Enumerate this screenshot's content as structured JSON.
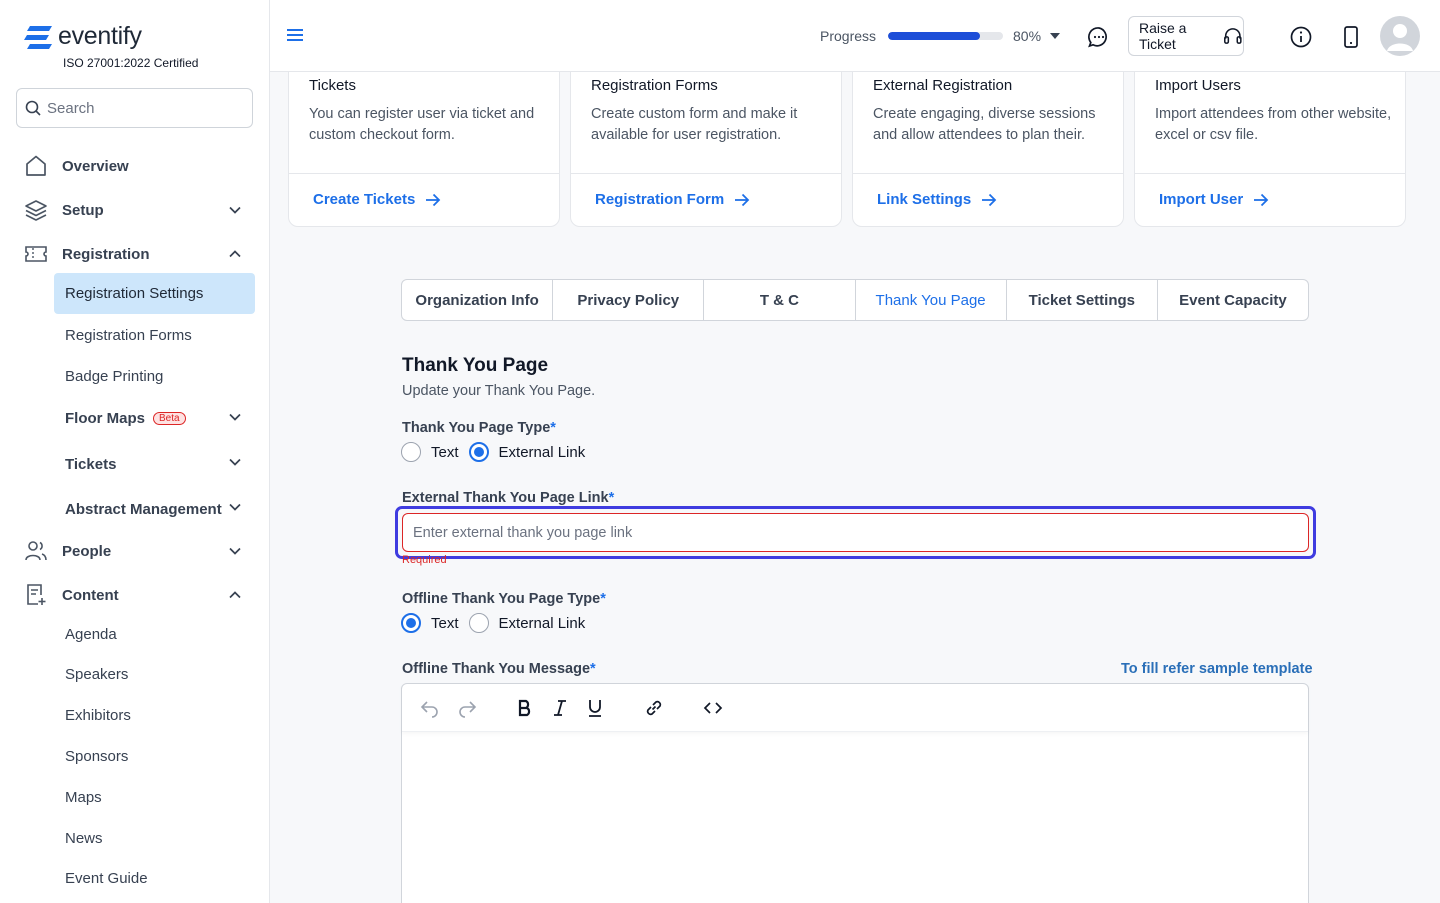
{
  "brand": {
    "name": "eventify",
    "certification": "ISO 27001:2022 Certified"
  },
  "search": {
    "placeholder": "Search"
  },
  "sidebar": {
    "overview": "Overview",
    "setup": "Setup",
    "registration": "Registration",
    "registration_items": [
      "Registration Settings",
      "Registration Forms",
      "Badge Printing"
    ],
    "floor_maps": "Floor Maps",
    "beta": "Beta",
    "tickets": "Tickets",
    "abstract": "Abstract Management",
    "people": "People",
    "content": "Content",
    "content_items": [
      "Agenda",
      "Speakers",
      "Exhibitors",
      "Sponsors",
      "Maps",
      "News",
      "Event Guide"
    ]
  },
  "header": {
    "progress_label": "Progress",
    "progress_value": 0.8,
    "progress_text": "80%",
    "raise_ticket": "Raise a Ticket"
  },
  "cards": [
    {
      "title": "Tickets",
      "desc": "You can register user via ticket and custom checkout form.",
      "link": "Create Tickets"
    },
    {
      "title": "Registration Forms",
      "desc": "Create custom form and make it available for user registration.",
      "link": "Registration Form"
    },
    {
      "title": "External Registration",
      "desc": "Create engaging, diverse sessions and allow attendees to plan their.",
      "link": "Link Settings"
    },
    {
      "title": "Import Users",
      "desc": "Import attendees from other website, excel or csv file.",
      "link": "Import User"
    }
  ],
  "tabs": [
    "Organization Info",
    "Privacy Policy",
    "T & C",
    "Thank You Page",
    "Ticket Settings",
    "Event Capacity"
  ],
  "active_tab": "Thank You Page",
  "form": {
    "title": "Thank You Page",
    "subtitle": "Update your Thank You Page.",
    "type_label": "Thank You Page Type",
    "option_text": "Text",
    "option_external": "External Link",
    "type_selected": "External Link",
    "link_label": "External Thank You Page Link",
    "link_placeholder": "Enter external thank you page link",
    "link_value": "",
    "required_msg": "Required",
    "offline_type_label": "Offline Thank You Page Type",
    "offline_type_selected": "Text",
    "offline_msg_label": "Offline Thank You Message",
    "sample_link": "To fill refer sample template",
    "asterisk": "*"
  },
  "colors": {
    "accent": "#1d6fe8",
    "error": "#dc2626",
    "active_bg": "#cde6fb",
    "focus": "#3f3ce0"
  }
}
